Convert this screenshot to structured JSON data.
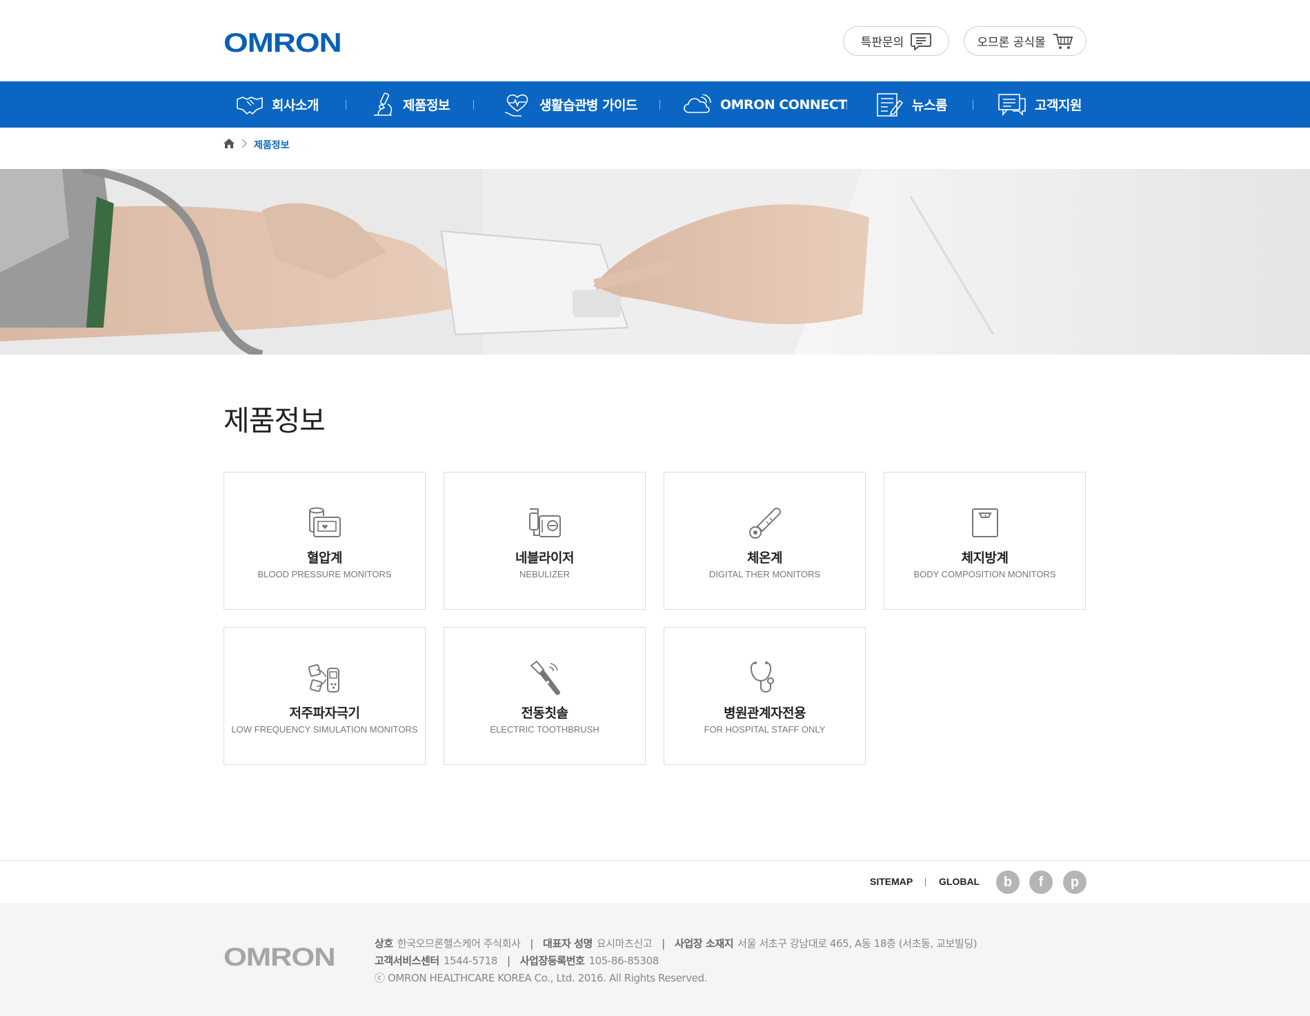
{
  "header": {
    "logo": "OMRON",
    "inquiry_label": "특판문의",
    "mall_label": "오므론 공식몰"
  },
  "nav": {
    "items": [
      {
        "label": "회사소개",
        "icon": "handshake-icon"
      },
      {
        "label": "제품정보",
        "icon": "microscope-icon"
      },
      {
        "label": "생활습관병 가이드",
        "icon": "heart-hand-icon"
      },
      {
        "label": "OMRON CONNECT",
        "icon": "cloud-icon"
      },
      {
        "label": "뉴스룸",
        "icon": "news-icon"
      },
      {
        "label": "고객지원",
        "icon": "chat-icon"
      }
    ]
  },
  "breadcrumb": {
    "home_icon": "home-icon",
    "current": "제품정보"
  },
  "page": {
    "title": "제품정보"
  },
  "products": [
    {
      "ko": "혈압계",
      "en": "BLOOD PRESSURE MONITORS",
      "icon": "blood-pressure-icon"
    },
    {
      "ko": "네블라이저",
      "en": "NEBULIZER",
      "icon": "nebulizer-icon"
    },
    {
      "ko": "체온계",
      "en": "DIGITAL THER MONITORS",
      "icon": "thermometer-icon"
    },
    {
      "ko": "체지방계",
      "en": "BODY COMPOSITION MONITORS",
      "icon": "scale-icon"
    },
    {
      "ko": "저주파자극기",
      "en": "LOW FREQUENCY SIMULATION MONITORS",
      "icon": "tens-icon"
    },
    {
      "ko": "전동칫솔",
      "en": "ELECTRIC TOOTHBRUSH",
      "icon": "toothbrush-icon"
    },
    {
      "ko": "병원관계자전용",
      "en": "FOR HOSPITAL STAFF ONLY",
      "icon": "stethoscope-icon"
    }
  ],
  "footer": {
    "links": [
      "SITEMAP",
      "GLOBAL"
    ],
    "sns": [
      "b",
      "f",
      "p"
    ],
    "logo": "OMRON",
    "company_label": "상호",
    "company": "한국오므론헬스케어 주식회사",
    "ceo_label": "대표자 성명",
    "ceo": "요시마츠신고",
    "address_label": "사업장 소재지",
    "address": "서울 서초구 강남대로 465, A동 18층 (서초동, 교보빌딩)",
    "service_label": "고객서비스센터",
    "service": "1544-5718",
    "reg_label": "사업장등록번호",
    "reg": "105-86-85308",
    "copyright": "ⓒ OMRON HEALTHCARE KOREA Co., Ltd. 2016. All Rights Reserved."
  },
  "colors": {
    "brand": "#0a66c2",
    "logo": "#0a5fb4"
  }
}
